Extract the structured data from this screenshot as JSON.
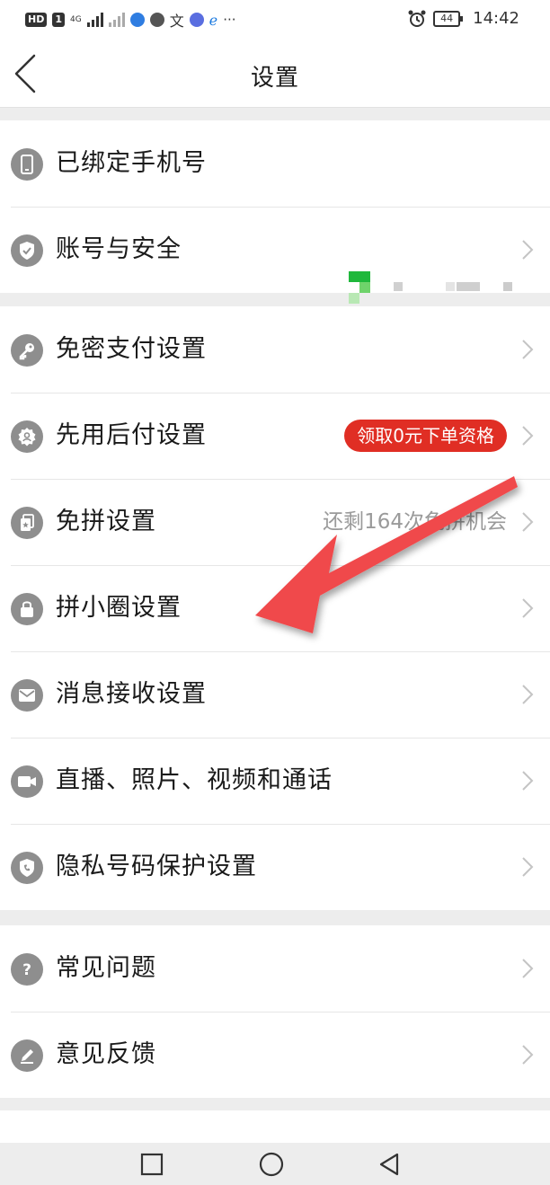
{
  "status_bar": {
    "network_badge": "HD",
    "sim": "1",
    "signal_1": "4G",
    "battery": "44",
    "time": "14:42"
  },
  "nav": {
    "title": "设置"
  },
  "groups": [
    {
      "items": [
        {
          "label": "已绑定手机号",
          "icon": "phone-icon"
        },
        {
          "label": "账号与安全",
          "icon": "shield-check-icon"
        }
      ]
    },
    {
      "items": [
        {
          "label": "免密支付设置",
          "icon": "key-icon"
        },
        {
          "label": "先用后付设置",
          "icon": "badge-icon",
          "pill": "领取0元下单资格"
        },
        {
          "label": "免拼设置",
          "icon": "card-star-icon",
          "extra": "还剩164次免拼机会"
        },
        {
          "label": "拼小圈设置",
          "icon": "lock-icon"
        },
        {
          "label": "消息接收设置",
          "icon": "mail-icon"
        },
        {
          "label": "直播、照片、视频和通话",
          "icon": "video-icon"
        },
        {
          "label": "隐私号码保护设置",
          "icon": "privacy-shield-icon"
        }
      ]
    },
    {
      "items": [
        {
          "label": "常见问题",
          "icon": "question-icon"
        },
        {
          "label": "意见反馈",
          "icon": "edit-icon"
        }
      ]
    }
  ],
  "colors": {
    "accent_red": "#e02e24",
    "annotation_arrow": "#f0494c"
  }
}
